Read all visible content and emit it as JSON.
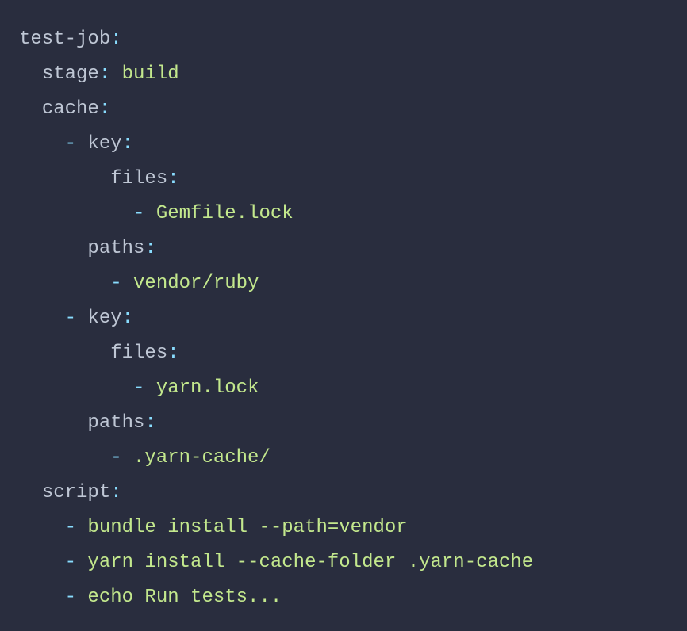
{
  "yaml": {
    "job_name": "test-job",
    "stage_key": "stage",
    "stage_value": "build",
    "cache_key": "cache",
    "key_key": "key",
    "files_key": "files",
    "paths_key": "paths",
    "script_key": "script",
    "cache": [
      {
        "files": [
          "Gemfile.lock"
        ],
        "paths": [
          "vendor/ruby"
        ]
      },
      {
        "files": [
          "yarn.lock"
        ],
        "paths": [
          ".yarn-cache/"
        ]
      }
    ],
    "script": [
      "bundle install --path=vendor",
      "yarn install --cache-folder .yarn-cache",
      "echo Run tests..."
    ]
  },
  "punct": {
    "colon": ":",
    "dash": "-"
  }
}
